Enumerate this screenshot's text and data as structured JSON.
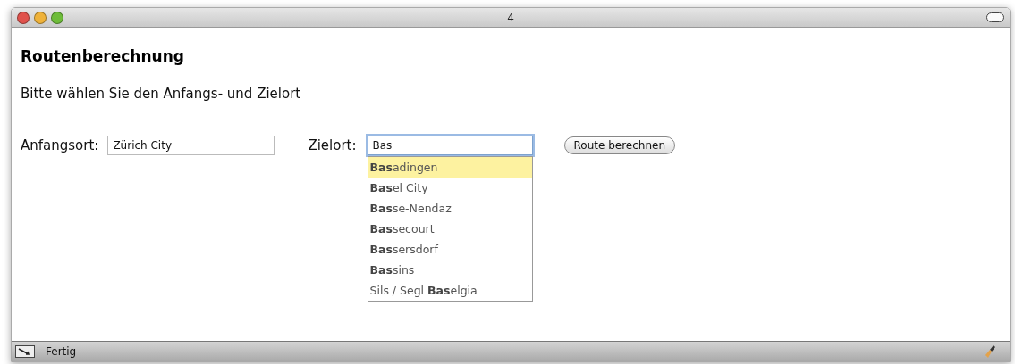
{
  "window": {
    "title": "4"
  },
  "heading": "Routenberechnung",
  "instruction": "Bitte wählen Sie den Anfangs- und Zielort",
  "start": {
    "label": "Anfangsort:",
    "value": "Zürich City"
  },
  "destination": {
    "label": "Zielort:",
    "value": "Bas",
    "focused": true
  },
  "button": "Route berechnen",
  "suggestions": [
    {
      "text": "**Bas**adingen",
      "selected": true
    },
    {
      "text": "**Bas**el City",
      "selected": false
    },
    {
      "text": "**Bas**se-Nendaz",
      "selected": false
    },
    {
      "text": "**Bas**secourt",
      "selected": false
    },
    {
      "text": "**Bas**sersdorf",
      "selected": false
    },
    {
      "text": "**Bas**sins",
      "selected": false
    },
    {
      "text": "Sils / Segl **Bas**elgia",
      "selected": false
    }
  ],
  "status_bar": {
    "text": "Fertig"
  }
}
